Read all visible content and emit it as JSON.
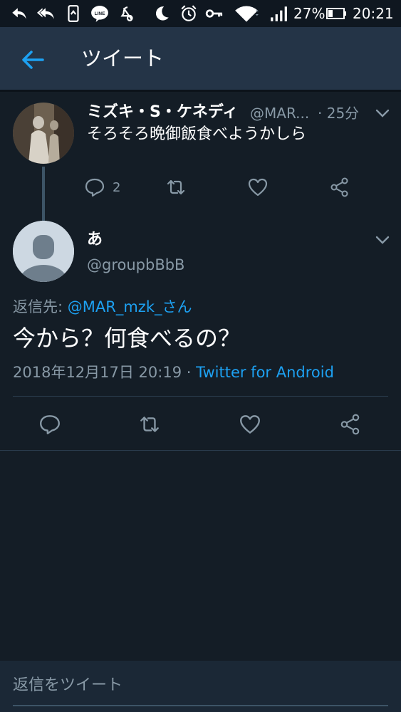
{
  "status_bar": {
    "battery_percent": "27%",
    "time": "20:21",
    "icons": [
      "reply-icon",
      "reply-all-icon",
      "phone-icon",
      "line-icon",
      "moon-icon",
      "alarm-icon",
      "key-icon",
      "wifi-icon",
      "signal-icon",
      "battery-icon"
    ]
  },
  "app_bar": {
    "title": "ツイート",
    "back_icon": "back-arrow-icon",
    "accent": "#1da1f2"
  },
  "parent_tweet": {
    "name": "ミズキ・S・ケネディ",
    "handle": "@MAR...",
    "time": "· 25分",
    "text": "そろそろ晩御飯食べようかしら",
    "reply_count": "2"
  },
  "main_tweet": {
    "name": "あ",
    "handle": "@groupbBbB",
    "reply_to_label": "返信先:",
    "reply_to_user": "@MAR_mzk_さん",
    "text": "今から？何食べるの？",
    "datetime": "2018年12月17日 20:19 ·",
    "client": "Twitter for Android"
  },
  "compose": {
    "placeholder": "返信をツイート"
  }
}
